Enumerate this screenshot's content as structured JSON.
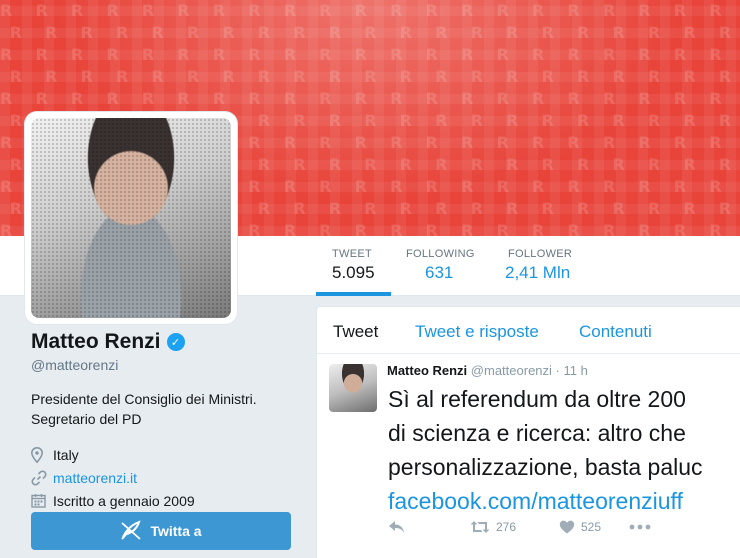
{
  "profile": {
    "name": "Matteo Renzi",
    "handle": "@matteorenzi",
    "bio": "Presidente del Consiglio dei Ministri. Segretario del PD",
    "location": "Italy",
    "website": "matteorenzi.it",
    "joined": "Iscritto a gennaio 2009",
    "tweet_button": "Twitta a"
  },
  "stats": [
    {
      "label": "TWEET",
      "value": "5.095"
    },
    {
      "label": "FOLLOWING",
      "value": "631"
    },
    {
      "label": "FOLLOWER",
      "value": "2,41 Mln"
    }
  ],
  "timeline": {
    "tabs": [
      "Tweet",
      "Tweet e risposte",
      "Contenuti"
    ]
  },
  "tweet": {
    "name": "Matteo Renzi",
    "handle": "@matteorenzi",
    "separator": "·",
    "time": "11 h",
    "lines": [
      "Sì al referendum da oltre 200",
      "di scienza e ricerca: altro che",
      "personalizzazione, basta paluc"
    ],
    "link": "facebook.com/matteorenziuff",
    "retweets": "276",
    "likes": "525"
  },
  "colors": {
    "banner": "#e8443a",
    "accent": "#1b95e0",
    "button": "#3c97d3",
    "verified": "#1da1f2"
  },
  "icons": [
    "verified-badge-icon",
    "location-pin-icon",
    "link-icon",
    "calendar-icon",
    "quill-icon",
    "reply-icon",
    "retweet-icon",
    "heart-icon",
    "more-icon"
  ]
}
